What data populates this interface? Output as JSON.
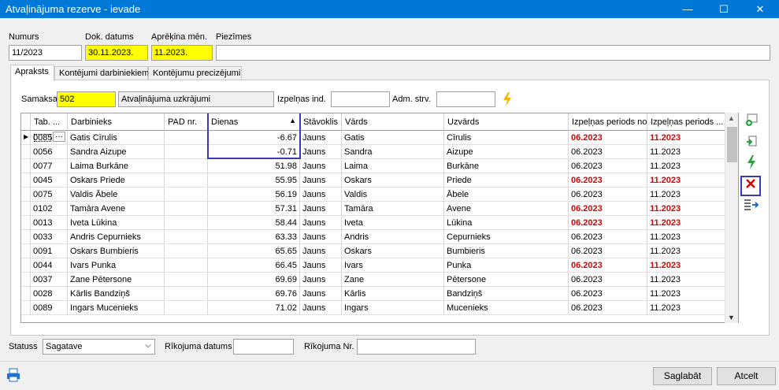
{
  "window": {
    "title": "Atvaļinājuma rezerve - ievade",
    "minimize": "—",
    "maximize": "☐",
    "close": "✕"
  },
  "header": {
    "numurs_label": "Numurs",
    "numurs_value": "11/2023",
    "dok_datums_label": "Dok. datums",
    "dok_datums_value": "30.11.2023.",
    "aprekina_label": "Aprēķina mēn.",
    "aprekina_value": "11.2023.",
    "piezimes_label": "Piezīmes",
    "piezimes_value": ""
  },
  "tabs": [
    "Apraksts",
    "Kontējumi darbiniekiem",
    "Kontējumu precizējumi"
  ],
  "form": {
    "samaksa_label": "Samaksa",
    "samaksa_code": "502",
    "samaksa_name": "Atvaļinājuma uzkrājumi",
    "izpelnas_label": "Izpelņas ind.",
    "izpelnas_value": "",
    "adm_label": "Adm. strv.",
    "adm_value": ""
  },
  "grid": {
    "columns": [
      "Tab. ...",
      "Darbinieks",
      "PAD nr.",
      "Dienas",
      "Stāvoklis",
      "Vārds",
      "Uzvārds",
      "Izpeļņas periods no",
      "Izpeļņas periods ..."
    ],
    "sort_indicator": "▲",
    "row_marker": "▶",
    "ellipsis": "···",
    "rows": [
      {
        "tab": "0085",
        "darbinieks": "Gatis Cīrulis",
        "pad": "",
        "dienas": "-6.67",
        "stav": "Jauns",
        "vards": "Gatis",
        "uzvards": "Cīrulis",
        "no": "06.2023",
        "lidz": "11.2023",
        "no_red": true,
        "lidz_red": true
      },
      {
        "tab": "0056",
        "darbinieks": "Sandra Aizupe",
        "pad": "",
        "dienas": "-0.71",
        "stav": "Jauns",
        "vards": "Sandra",
        "uzvards": "Aizupe",
        "no": "06.2023",
        "lidz": "11.2023",
        "no_red": false,
        "lidz_red": false
      },
      {
        "tab": "0077",
        "darbinieks": "Laima Burkāne",
        "pad": "",
        "dienas": "51.98",
        "stav": "Jauns",
        "vards": "Laima",
        "uzvards": "Burkāne",
        "no": "06.2023",
        "lidz": "11.2023",
        "no_red": false,
        "lidz_red": false
      },
      {
        "tab": "0045",
        "darbinieks": "Oskars Priede",
        "pad": "",
        "dienas": "55.95",
        "stav": "Jauns",
        "vards": "Oskars",
        "uzvards": "Priede",
        "no": "06.2023",
        "lidz": "11.2023",
        "no_red": true,
        "lidz_red": true
      },
      {
        "tab": "0075",
        "darbinieks": "Valdis Ābele",
        "pad": "",
        "dienas": "56.19",
        "stav": "Jauns",
        "vards": "Valdis",
        "uzvards": "Ābele",
        "no": "06.2023",
        "lidz": "11.2023",
        "no_red": false,
        "lidz_red": false
      },
      {
        "tab": "0102",
        "darbinieks": "Tamāra Avene",
        "pad": "",
        "dienas": "57.31",
        "stav": "Jauns",
        "vards": "Tamāra",
        "uzvards": "Avene",
        "no": "06.2023",
        "lidz": "11.2023",
        "no_red": true,
        "lidz_red": true
      },
      {
        "tab": "0013",
        "darbinieks": "Iveta Lūkina",
        "pad": "",
        "dienas": "58.44",
        "stav": "Jauns",
        "vards": "Iveta",
        "uzvards": "Lūkina",
        "no": "06.2023",
        "lidz": "11.2023",
        "no_red": true,
        "lidz_red": true
      },
      {
        "tab": "0033",
        "darbinieks": "Andris Cepurnieks",
        "pad": "",
        "dienas": "63.33",
        "stav": "Jauns",
        "vards": "Andris",
        "uzvards": "Cepurnieks",
        "no": "06.2023",
        "lidz": "11.2023",
        "no_red": false,
        "lidz_red": false
      },
      {
        "tab": "0091",
        "darbinieks": "Oskars Bumbieris",
        "pad": "",
        "dienas": "65.65",
        "stav": "Jauns",
        "vards": "Oskars",
        "uzvards": "Bumbieris",
        "no": "06.2023",
        "lidz": "11.2023",
        "no_red": false,
        "lidz_red": false
      },
      {
        "tab": "0044",
        "darbinieks": "Ivars Punka",
        "pad": "",
        "dienas": "66.45",
        "stav": "Jauns",
        "vards": "Ivars",
        "uzvards": "Punka",
        "no": "06.2023",
        "lidz": "11.2023",
        "no_red": true,
        "lidz_red": true
      },
      {
        "tab": "0037",
        "darbinieks": "Zane Pētersone",
        "pad": "",
        "dienas": "69.69",
        "stav": "Jauns",
        "vards": "Zane",
        "uzvards": "Pētersone",
        "no": "06.2023",
        "lidz": "11.2023",
        "no_red": false,
        "lidz_red": false
      },
      {
        "tab": "0028",
        "darbinieks": "Kārlis Bandziņš",
        "pad": "",
        "dienas": "69.76",
        "stav": "Jauns",
        "vards": "Kārlis",
        "uzvards": "Bandziņš",
        "no": "06.2023",
        "lidz": "11.2023",
        "no_red": false,
        "lidz_red": false
      },
      {
        "tab": "0089",
        "darbinieks": "Ingars Mucenieks",
        "pad": "",
        "dienas": "71.02",
        "stav": "Jauns",
        "vards": "Ingars",
        "uzvards": "Mucenieks",
        "no": "06.2023",
        "lidz": "11.2023",
        "no_red": false,
        "lidz_red": false
      }
    ]
  },
  "footer": {
    "statuss_label": "Statuss",
    "statuss_value": "Sagatave",
    "rikojuma_datums_label": "Rīkojuma datums",
    "rikojuma_datums_value": "",
    "rikojuma_nr_label": "Rīkojuma Nr.",
    "rikojuma_nr_value": "",
    "save_label": "Saglabāt",
    "cancel_label": "Atcelt"
  },
  "colors": {
    "title_bar": "#0078d7",
    "required_field": "#ffff00",
    "highlight_box": "#3a3ab8",
    "warning_text": "#e00000"
  }
}
